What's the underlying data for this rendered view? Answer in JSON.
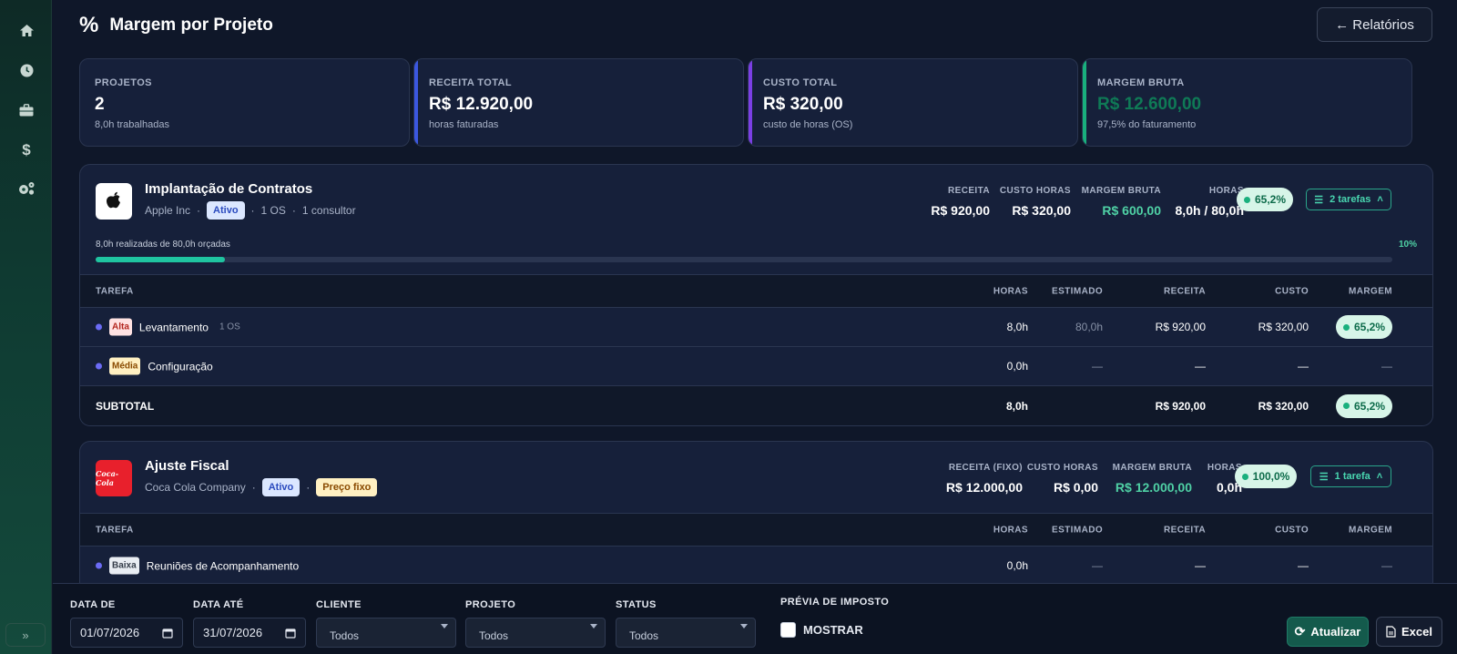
{
  "header": {
    "title": "Margem por Projeto",
    "title_icon": "%",
    "back_label": "← Relatórios"
  },
  "colors": {
    "accent_green": "#4fd1a5",
    "accent_blue": "#3b57e0",
    "accent_purple": "#7b3fe4",
    "accent_margin": "#19b07d"
  },
  "cards": [
    {
      "label": "PROJETOS",
      "value": "2",
      "sub": "8,0h trabalhadas"
    },
    {
      "label": "RECEITA TOTAL",
      "value": "R$ 12.920,00",
      "sub": "horas faturadas"
    },
    {
      "label": "CUSTO TOTAL",
      "value": "R$ 320,00",
      "sub": "custo de horas (OS)"
    },
    {
      "label": "MARGEM BRUTA",
      "value": "R$ 12.600,00",
      "sub": "97,5% do faturamento"
    }
  ],
  "projects": [
    {
      "name": "Implantação de Contratos",
      "client": "Apple Inc",
      "status": "Ativo",
      "os_count": "1 OS",
      "consultants": "1 consultor",
      "metrics": [
        {
          "label": "RECEITA",
          "value": "R$ 920,00"
        },
        {
          "label": "CUSTO HORAS",
          "value": "R$ 320,00"
        },
        {
          "label": "MARGEM BRUTA",
          "value": "R$ 600,00"
        },
        {
          "label": "HORAS",
          "value": "8,0h / 80,0h"
        }
      ],
      "margin_pct": "65,2%",
      "tasks_label": "2 tarefas",
      "progress_label": "8,0h realizadas de 80,0h orçadas",
      "progress_pct": "10%",
      "progress_value": 10,
      "table_headers": [
        "TAREFA",
        "HORAS",
        "ESTIMADO",
        "RECEITA",
        "CUSTO",
        "MARGEM"
      ],
      "tasks": [
        {
          "priority": "Alta",
          "name": "Levantamento",
          "os": "1 OS",
          "hours": "8,0h",
          "estimated": "80,0h",
          "revenue": "R$ 920,00",
          "cost": "R$ 320,00",
          "margin": "65,2%"
        },
        {
          "priority": "Média",
          "name": "Configuração",
          "os": "",
          "hours": "0,0h",
          "estimated": "—",
          "revenue": "—",
          "cost": "—",
          "margin": "—"
        }
      ],
      "subtotal": {
        "label": "SUBTOTAL",
        "hours": "8,0h",
        "revenue": "R$ 920,00",
        "cost": "R$ 320,00",
        "margin": "65,2%"
      }
    },
    {
      "name": "Ajuste Fiscal",
      "client": "Coca Cola Company",
      "status": "Ativo",
      "pricing": "Preço fixo",
      "logo_text": "Coca-Cola",
      "metrics": [
        {
          "label": "RECEITA (FIXO)",
          "value": "R$ 12.000,00"
        },
        {
          "label": "CUSTO HORAS",
          "value": "R$ 0,00"
        },
        {
          "label": "MARGEM BRUTA",
          "value": "R$ 12.000,00"
        },
        {
          "label": "HORAS",
          "value": "0,0h"
        }
      ],
      "margin_pct": "100,0%",
      "tasks_label": "1 tarefa",
      "table_headers": [
        "TAREFA",
        "HORAS",
        "ESTIMADO",
        "RECEITA",
        "CUSTO",
        "MARGEM"
      ],
      "tasks": [
        {
          "priority": "Baixa",
          "name": "Reuniões de Acompanhamento",
          "hours": "0,0h",
          "estimated": "—",
          "revenue": "—",
          "cost": "—",
          "margin": "—"
        }
      ]
    }
  ],
  "filters": {
    "date_from_label": "DATA DE",
    "date_from": "01/07/2026",
    "date_to_label": "DATA ATÉ",
    "date_to": "31/07/2026",
    "client_label": "CLIENTE",
    "client_value": "Todos",
    "project_label": "PROJETO",
    "project_value": "Todos",
    "status_label": "STATUS",
    "status_value": "Todos",
    "tax_label": "PRÉVIA DE IMPOSTO",
    "tax_check_label": "MOSTRAR",
    "refresh_label": "Atualizar",
    "excel_label": "Excel"
  },
  "sidebar": {
    "items": [
      "home-icon",
      "clock-icon",
      "briefcase-icon",
      "dollar-icon",
      "gears-icon"
    ],
    "expand_label": "»"
  }
}
